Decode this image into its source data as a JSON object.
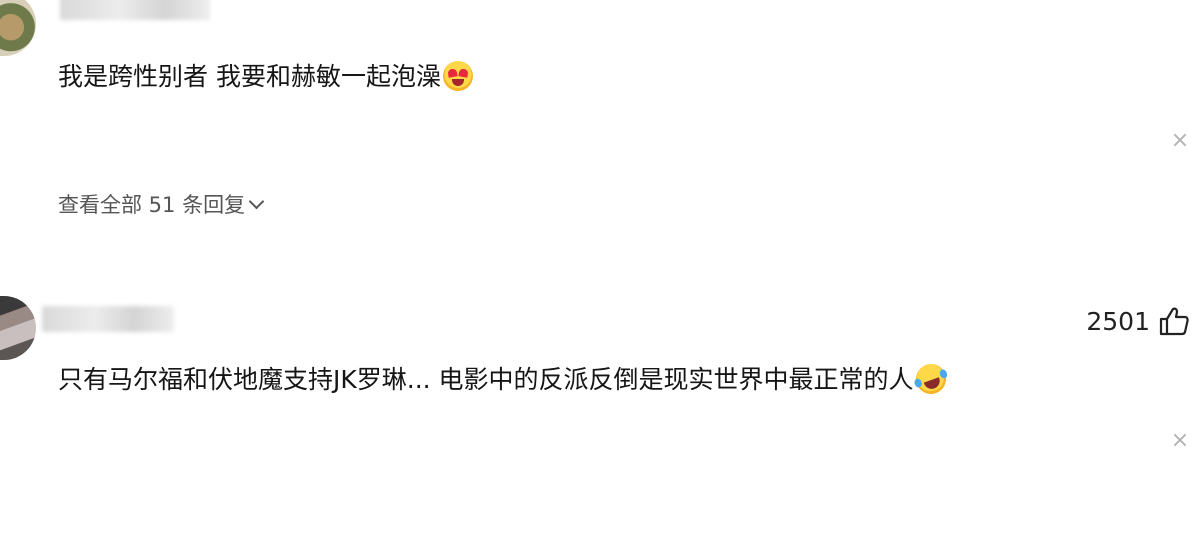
{
  "comments": [
    {
      "text": "我是跨性别者 我要和赫敏一起泡澡",
      "emoji": "heart-eyes-emoji",
      "replies_label": "查看全部 51 条回复"
    },
    {
      "text": "只有马尔福和伏地魔支持JK罗琳... 电影中的反派反倒是现实世界中最正常的人",
      "emoji": "rolling-laughing-emoji",
      "like_count": "2501"
    }
  ],
  "icons": {
    "close": "close-icon",
    "like": "thumbs-up-icon",
    "expand": "chevron-down-icon"
  },
  "colors": {
    "text": "#161616",
    "secondary_text": "#555555",
    "close_icon": "#b5b5b5",
    "background": "#ffffff"
  }
}
